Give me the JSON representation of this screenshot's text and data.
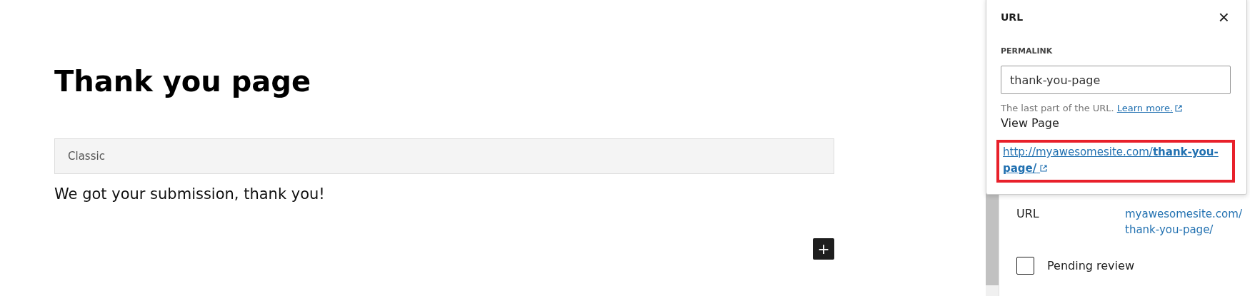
{
  "editor": {
    "title": "Thank you page",
    "classic_block": {
      "label": "Classic"
    },
    "paragraph": "We got your submission, thank you!",
    "add_block_button": {
      "label": "+"
    }
  },
  "sidebar": {
    "url_row": {
      "label": "URL",
      "value": "myawesomesite.com/ thank-you-page/"
    },
    "pending_review": {
      "label": "Pending review",
      "checked": false
    }
  },
  "url_popover": {
    "title": "URL",
    "close_button": "×",
    "permalink_label": "PERMALINK",
    "slug_field": {
      "value": "thank-you-page"
    },
    "help_text": "The last part of the URL.",
    "learn_more_link": "Learn more.",
    "view_page_label": "View Page",
    "page_link": "http://myawesomesite.com/**thank-you-page/**",
    "link_highlighted": true
  }
}
